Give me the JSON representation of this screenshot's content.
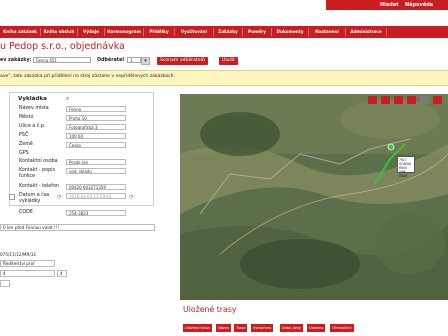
{
  "topbar": {
    "link_hledat": "Hledat",
    "link_napoveda": "Nápověda"
  },
  "nav": {
    "items": [
      "Kniha zakázek",
      "Kniha obsluh",
      "Výdaje",
      "Harmonogram",
      "Přidělky",
      "Vyúčtování",
      "Zakázky",
      "Poměry",
      "Dokumenty",
      "Nastavení",
      "Administrace"
    ]
  },
  "page": {
    "title": "u Pedop s.r.o., objednávka"
  },
  "filter": {
    "label": "ev zakázky:",
    "value": "Fenna 451",
    "odberatel_label": "Odběratel",
    "odberatel_value": "1",
    "btn_seznam": "Seznam odběratelů",
    "btn_ulozit": "Uložit"
  },
  "warning": {
    "text": "ave\", tato zakázka při přidělení na stroj zůstane v nepřidělených zakázkách."
  },
  "vykladka": {
    "heading": "Vykládka",
    "rows": [
      {
        "label": "Název místa",
        "value": "Fenna"
      },
      {
        "label": "Město",
        "value": "Praha 10"
      },
      {
        "label": "Ulice a č.p.",
        "value": "Fotografická 3"
      },
      {
        "label": "PSČ",
        "value": "100 00"
      },
      {
        "label": "Země",
        "value": "Česko"
      },
      {
        "label": "GPS",
        "value": ""
      },
      {
        "label": "Kontaktní osoba",
        "value": "Pecák Jan"
      },
      {
        "label": "Kontakt - popis funkce",
        "value": "ved. skladu"
      },
      {
        "label": "Kontakt - telefon",
        "value": "00420 603271359"
      },
      {
        "label": "Datum a čas vykládky",
        "value": "2015-12-03 12:59:01"
      },
      {
        "label": "CODE",
        "value": "254-3823"
      }
    ]
  },
  "note": {
    "text": "0 km před Fennou volat !!!"
  },
  "left_misc": {
    "line1": "075/11/12/MR/31",
    "line2": "Ředitelství proř",
    "line3": "4",
    "line4": "4"
  },
  "map": {
    "marker_label_1": "79c7",
    "marker_label_2": "SCANIA R500",
    "marker_label_3": "5XB 9246",
    "button_colors": [
      "#c81e22",
      "#c81e22",
      "#c81e22",
      "#c81e22",
      "#7a7a7a",
      "#c81e22",
      "#c81e22"
    ]
  },
  "saved_routes": {
    "heading": "Uložené trasy",
    "columns": [
      "Uložená trasa",
      "Název",
      "Trasa",
      "Vytvořeno",
      "Doba jízdy",
      "Uloženo",
      "Ohraničení"
    ]
  }
}
